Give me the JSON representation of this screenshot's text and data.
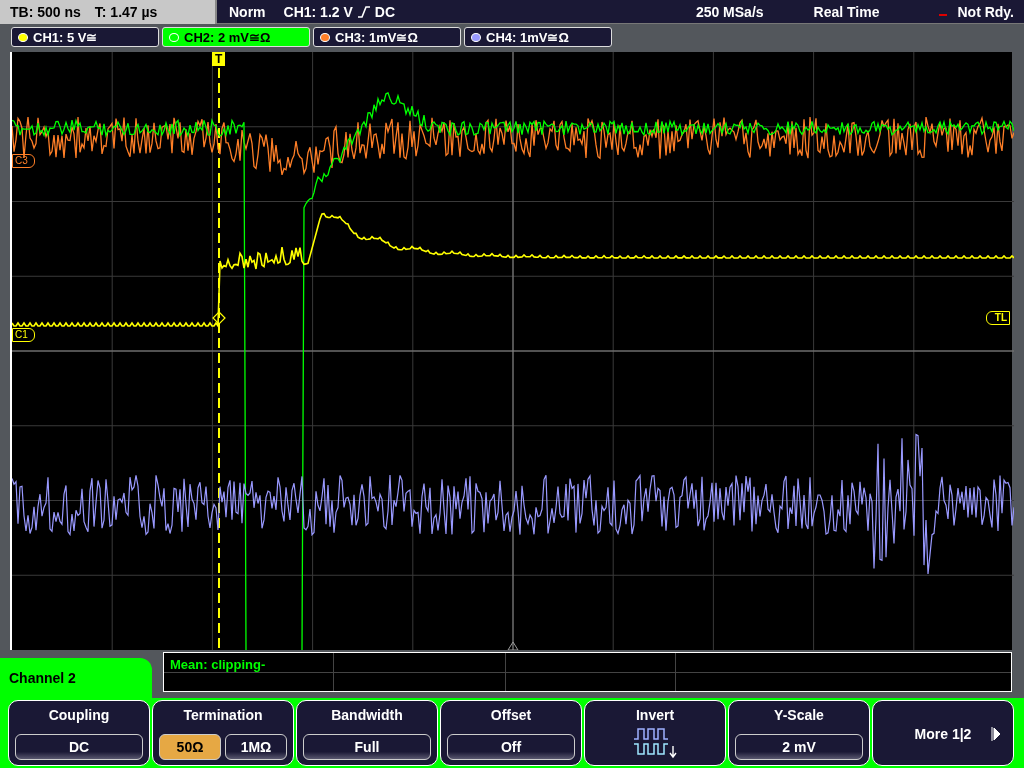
{
  "top_bar": {
    "timebase": "TB: 500 ns",
    "trigger_time": "T: 1.47 µs",
    "mode": "Norm",
    "trigger": "CH1: 1.2 V",
    "coupling": "DC",
    "sample_rate": "250 MSa/s",
    "acquisition": "Real Time",
    "status": "Not Rdy."
  },
  "channels": [
    {
      "label": "CH1: 5 V≅",
      "color": "#ffff00",
      "selected": false
    },
    {
      "label": "CH2: 2 mV≅Ω",
      "color": "#00ff00",
      "selected": true
    },
    {
      "label": "CH3: 1mV≅Ω",
      "color": "#ff7f27",
      "selected": false
    },
    {
      "label": "CH4: 1mV≅Ω",
      "color": "#9999ff",
      "selected": false
    }
  ],
  "graticule": {
    "trigger_marker": "T",
    "level_marker": "TL",
    "markers": [
      {
        "label": "C3",
        "color": "#ff7f27"
      },
      {
        "label": "C1",
        "color": "#ffff00"
      }
    ]
  },
  "measurement": {
    "text": "Mean: clipping-"
  },
  "menu": {
    "title": "Channel 2",
    "softkeys": [
      {
        "kind": "options",
        "label": "Coupling",
        "options": [
          {
            "label": "DC",
            "selected": false
          }
        ]
      },
      {
        "kind": "options",
        "label": "Termination",
        "options": [
          {
            "label": "50Ω",
            "selected": true
          },
          {
            "label": "1MΩ",
            "selected": false
          }
        ]
      },
      {
        "kind": "options",
        "label": "Bandwidth",
        "options": [
          {
            "label": "Full",
            "selected": false
          }
        ]
      },
      {
        "kind": "options",
        "label": "Offset",
        "options": [
          {
            "label": "Off",
            "selected": false
          }
        ]
      },
      {
        "kind": "icon",
        "label": "Invert"
      },
      {
        "kind": "options",
        "label": "Y-Scale",
        "options": [
          {
            "label": "2 mV",
            "selected": false
          }
        ]
      },
      {
        "kind": "next",
        "label": "More 1|2"
      }
    ]
  }
}
